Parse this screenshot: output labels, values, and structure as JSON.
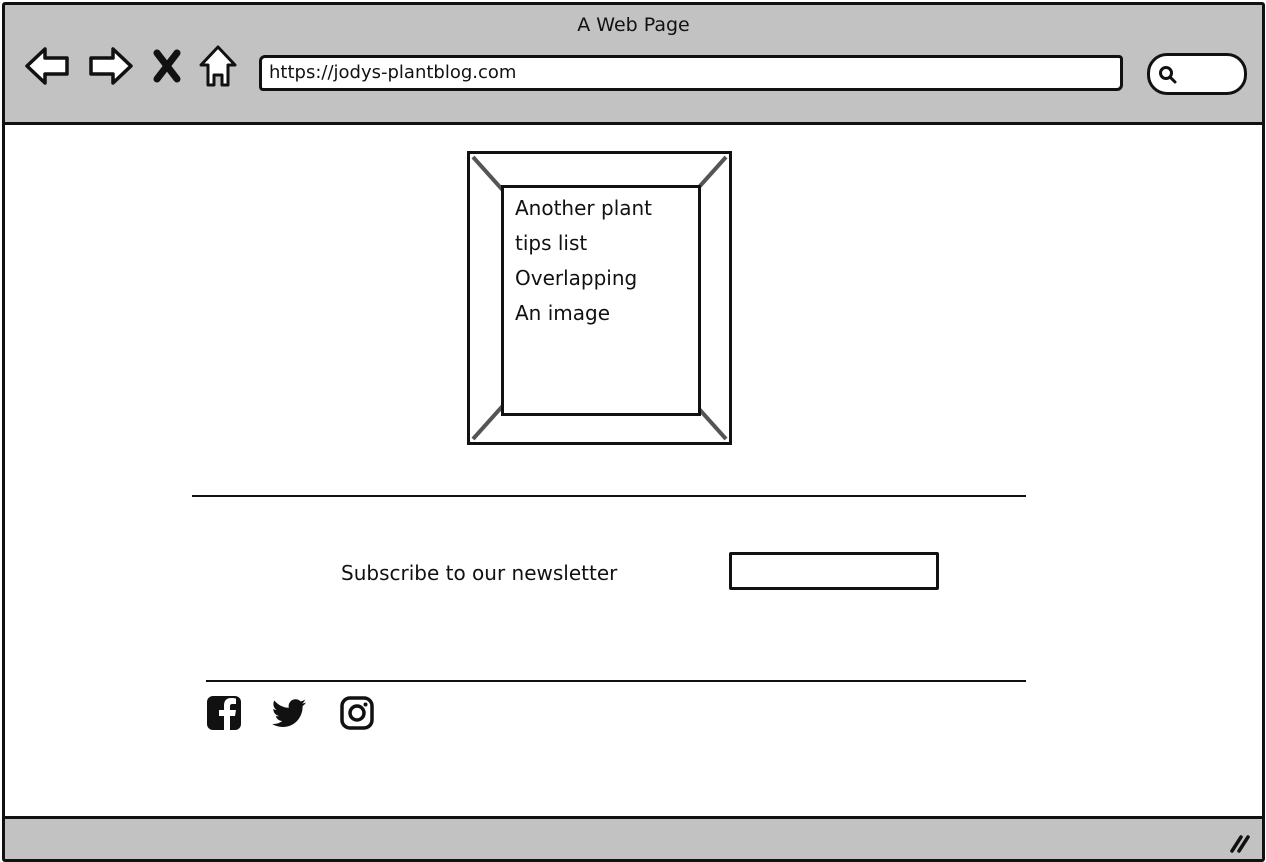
{
  "window": {
    "title": "A Web Page"
  },
  "toolbar": {
    "back_icon": "back-arrow-icon",
    "forward_icon": "forward-arrow-icon",
    "stop_icon": "close-icon",
    "home_icon": "home-icon",
    "url": "https://jodys-plantblog.com",
    "search_icon": "search-icon"
  },
  "content": {
    "image_placeholder": {
      "overlay_lines": [
        "Another plant",
        "tips list",
        "Overlapping",
        "An image"
      ]
    },
    "newsletter": {
      "label": "Subscribe to our newsletter",
      "input_value": ""
    },
    "social_links": [
      {
        "icon": "facebook-icon"
      },
      {
        "icon": "twitter-icon"
      },
      {
        "icon": "instagram-icon"
      }
    ]
  },
  "colors": {
    "chrome": "#c2c2c2",
    "ink": "#111111",
    "page": "#ffffff"
  }
}
